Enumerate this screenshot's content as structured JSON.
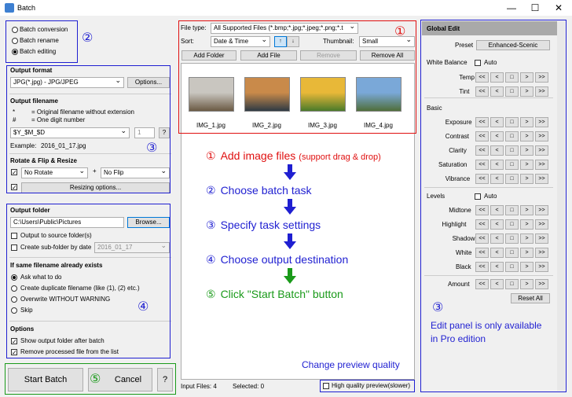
{
  "window": {
    "title": "Batch",
    "min": "—",
    "max": "☐",
    "close": "✕"
  },
  "tasks": {
    "items": [
      "Batch conversion",
      "Batch rename",
      "Batch editing"
    ],
    "selected": 2,
    "marker": "②"
  },
  "output_format": {
    "title": "Output format",
    "format": "JPG(*.jpg) - JPG/JPEG",
    "options_btn": "Options..."
  },
  "output_filename": {
    "title": "Output filename",
    "legend1_key": "*",
    "legend1": "= Original filename without extension",
    "legend2_key": "#",
    "legend2": "= One digit number",
    "pattern": "$Y_$M_$D",
    "number": "1",
    "help": "?",
    "example_label": "Example:",
    "example": "2016_01_17.jpg"
  },
  "rotate": {
    "title": "Rotate & Flip & Resize",
    "rotate": "No Rotate",
    "plus": "+",
    "flip": "No Flip",
    "resize_btn": "Resizing options...",
    "marker": "③"
  },
  "output_folder": {
    "title": "Output folder",
    "path": "C:\\Users\\Public\\Pictures",
    "browse": "Browse...",
    "to_source": "Output to source folder(s)",
    "subfolder": "Create sub-folder by date",
    "subfolder_val": "2016_01_17"
  },
  "same_name": {
    "title": "If same filename already exists",
    "options": [
      "Ask what to do",
      "Create duplicate filename (like (1), (2) etc.)",
      "Overwrite WITHOUT WARNING",
      "Skip"
    ],
    "selected": 0,
    "marker": "④"
  },
  "options": {
    "title": "Options",
    "show_folder": "Show output folder after batch",
    "remove_processed": "Remove processed file from the list"
  },
  "bottom": {
    "start": "Start Batch",
    "cancel": "Cancel",
    "help": "?",
    "marker": "⑤"
  },
  "files": {
    "file_type_label": "File type:",
    "file_type": "All Supported Files (*.bmp;*.jpg;*.jpeg;*.png;*.t",
    "sort_label": "Sort:",
    "sort": "Date & Time",
    "sort_up": "↑",
    "sort_down": "↓",
    "thumb_label": "Thumbnail:",
    "thumb": "Small",
    "add_folder": "Add Folder",
    "add_file": "Add File",
    "remove": "Remove",
    "remove_all": "Remove All",
    "marker": "①",
    "thumbs": [
      {
        "name": "IMG_1.jpg",
        "c1": "#c9c6c0",
        "c2": "#6b5a44"
      },
      {
        "name": "IMG_2.jpg",
        "c1": "#c98a4a",
        "c2": "#2e3a44"
      },
      {
        "name": "IMG_3.jpg",
        "c1": "#e8b838",
        "c2": "#4a7a2a"
      },
      {
        "name": "IMG_4.jpg",
        "c1": "#7aa8d8",
        "c2": "#4f6e3a"
      }
    ]
  },
  "steps": [
    {
      "num": "①",
      "text": "Add image files",
      "extra": "(support drag & drop)",
      "color": "#e01010"
    },
    {
      "num": "②",
      "text": "Choose batch task",
      "extra": "",
      "color": "#1f1fd1"
    },
    {
      "num": "③",
      "text": "Specify task settings",
      "extra": "",
      "color": "#1f1fd1"
    },
    {
      "num": "④",
      "text": "Choose output destination",
      "extra": "",
      "color": "#1f1fd1"
    },
    {
      "num": "⑤",
      "text": "Click \"Start Batch\" button",
      "extra": "",
      "color": "#1a9a1a"
    }
  ],
  "preview_note": "Change preview quality",
  "status": {
    "input_files": "Input Files: 4",
    "selected": "Selected: 0",
    "hq": "High quality preview(slower)"
  },
  "global_edit": {
    "title": "Global Edit",
    "preset_label": "Preset",
    "preset": "Enhanced-Scenic",
    "wb": "White Balance",
    "auto": "Auto",
    "wb_rows": [
      "Temp",
      "Tint"
    ],
    "basic": "Basic",
    "basic_rows": [
      "Exposure",
      "Contrast",
      "Clarity",
      "Saturation",
      "Vibrance"
    ],
    "levels": "Levels",
    "levels_rows": [
      "Midtone",
      "Highlight",
      "Shadow",
      "White",
      "Black"
    ],
    "amount": "Amount",
    "reset": "Reset All",
    "buttons": [
      "<<",
      "<",
      "□",
      ">",
      ">>"
    ],
    "marker": "③",
    "note1": "Edit panel is only available",
    "note2": "in Pro edition"
  }
}
